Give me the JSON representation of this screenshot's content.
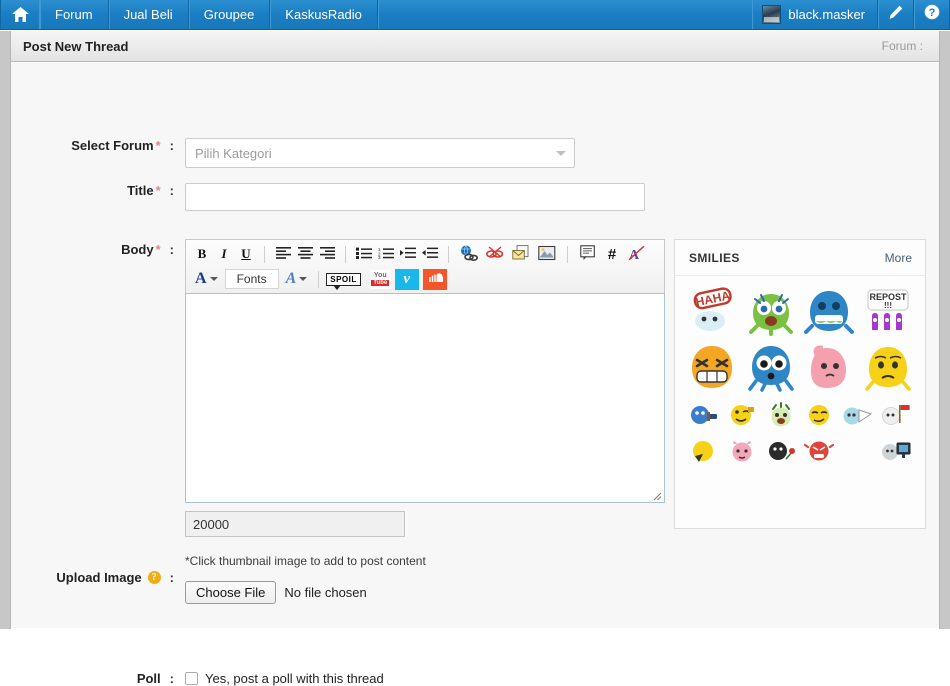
{
  "nav": {
    "home_icon": "home-icon",
    "items": [
      {
        "label": "Forum"
      },
      {
        "label": "Jual Beli"
      },
      {
        "label": "Groupee"
      },
      {
        "label": "KaskusRadio"
      }
    ],
    "user": {
      "name": "black.masker",
      "avatar_icon": "user-avatar"
    },
    "edit_icon": "pencil-icon",
    "help_icon": "question-circle-icon"
  },
  "panel": {
    "title": "Post New Thread",
    "forum_label": "Forum :"
  },
  "form": {
    "select_forum": {
      "label": "Select Forum",
      "required": "*",
      "colon": ":",
      "placeholder": "Pilih Kategori",
      "value": "Pilih Kategori",
      "caret_icon": "chevron-down-icon"
    },
    "title": {
      "label": "Title",
      "required": "*",
      "colon": ":",
      "value": "",
      "placeholder": ""
    },
    "body": {
      "label": "Body",
      "required": "*",
      "colon": ":",
      "value": "",
      "char_limit": "20000"
    },
    "upload": {
      "label": "Upload Image",
      "colon": ":",
      "help_icon": "help-circle-icon",
      "help_glyph": "?",
      "note": "*Click thumbnail image to add to post content",
      "button": "Choose File",
      "status": "No file chosen"
    },
    "poll": {
      "label": "Poll",
      "colon": ":",
      "checkbox_label": "Yes, post a poll with this thread",
      "checked": false
    }
  },
  "toolbar": {
    "row1": [
      {
        "name": "bold-icon",
        "glyph": "B"
      },
      {
        "name": "italic-icon",
        "glyph": "I"
      },
      {
        "name": "underline-icon",
        "glyph": "U"
      },
      {
        "name": "align-left-icon",
        "glyph": ""
      },
      {
        "name": "align-center-icon",
        "glyph": ""
      },
      {
        "name": "align-right-icon",
        "glyph": ""
      },
      {
        "name": "bullet-list-icon",
        "glyph": ""
      },
      {
        "name": "numbered-list-icon",
        "glyph": ""
      },
      {
        "name": "indent-increase-icon",
        "glyph": ""
      },
      {
        "name": "indent-decrease-icon",
        "glyph": ""
      },
      {
        "name": "insert-link-icon",
        "glyph": ""
      },
      {
        "name": "remove-link-icon",
        "glyph": ""
      },
      {
        "name": "insert-email-icon",
        "glyph": ""
      },
      {
        "name": "insert-image-icon",
        "glyph": ""
      },
      {
        "name": "quote-icon",
        "glyph": ""
      },
      {
        "name": "code-hash-icon",
        "glyph": "#"
      },
      {
        "name": "remove-format-icon",
        "glyph": ""
      }
    ],
    "font_color_label": "A",
    "fonts_label": "Fonts",
    "font_size_label": "A",
    "spoil_label": "SPOIL",
    "youtube_top": "You",
    "youtube_bottom": "Tube",
    "vimeo_label": "v",
    "soundcloud_name": "soundcloud-icon"
  },
  "smilies": {
    "title": "SMILIES",
    "more": "More",
    "big": [
      {
        "name": "smiley-haha",
        "colors": [
          "#ffffff",
          "#c9302c",
          "#d9edf7"
        ]
      },
      {
        "name": "smiley-green-monster",
        "colors": [
          "#7ac143",
          "#2b6cb0",
          "#ffffff"
        ]
      },
      {
        "name": "smiley-blue-teeth",
        "colors": [
          "#2f86c5",
          "#ffffff",
          "#8fd14f"
        ]
      },
      {
        "name": "smiley-repost",
        "colors": [
          "#a937c9",
          "#ffffff",
          "#5b2a86"
        ]
      },
      {
        "name": "smiley-orange-grin",
        "colors": [
          "#f5a623",
          "#ffffff",
          "#333333"
        ]
      },
      {
        "name": "smiley-blue-surprised",
        "colors": [
          "#2f86c5",
          "#ffffff",
          "#222222"
        ]
      },
      {
        "name": "smiley-pink-shy",
        "colors": [
          "#f4a0ae",
          "#ffffff",
          "#333333"
        ]
      },
      {
        "name": "smiley-yellow-sad",
        "colors": [
          "#f7d117",
          "#ffffff",
          "#333333"
        ]
      }
    ],
    "small": [
      {
        "name": "smiley-blue-hammer",
        "color": "#3a7dc9"
      },
      {
        "name": "smiley-yellow-wink",
        "color": "#f5d117"
      },
      {
        "name": "smiley-green-party",
        "color": "#bfe08a"
      },
      {
        "name": "smiley-yellow-smirk",
        "color": "#f7d117"
      },
      {
        "name": "smiley-blue-flag-white",
        "color": "#a9d8e8"
      },
      {
        "name": "smiley-white-flag-red",
        "color": "#efefef"
      },
      {
        "name": "smiley-yellow-sleep",
        "color": "#f7d117"
      },
      {
        "name": "smiley-pink-blush",
        "color": "#f4a7b9"
      },
      {
        "name": "smiley-black-rose",
        "color": "#2b2b2b"
      },
      {
        "name": "smiley-red-angry",
        "color": "#e0453c"
      },
      {
        "name": "smiley-blank",
        "color": "transparent"
      },
      {
        "name": "smiley-grey-monitor",
        "color": "#cfd4d8"
      }
    ]
  },
  "colors": {
    "nav_blue": "#1b7ec2",
    "accent_red": "#e0868b",
    "help_orange": "#f0ad15",
    "textarea_border": "#a9c3d1"
  }
}
